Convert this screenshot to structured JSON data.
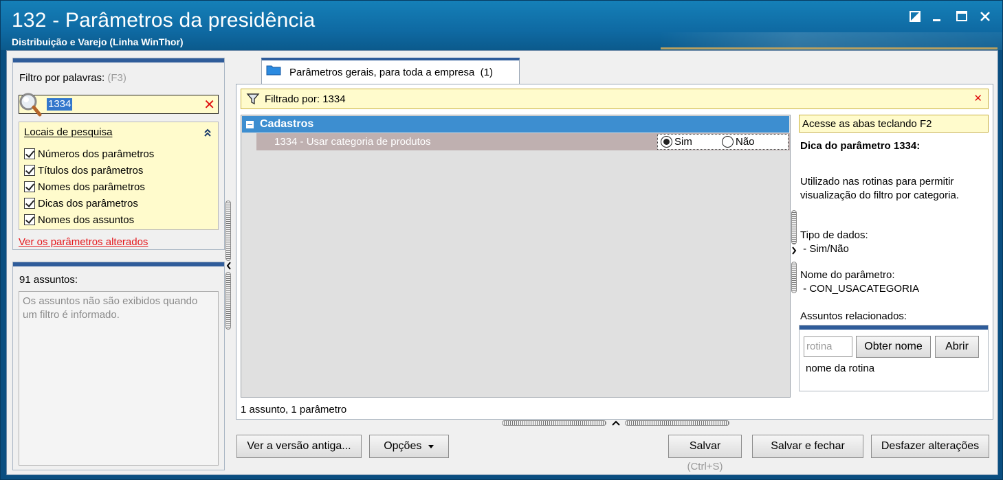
{
  "window": {
    "title": "132 - Parâmetros da presidência",
    "subtitle": "Distribuição e Varejo (Linha WinThor)",
    "controls": [
      "restore-icon",
      "minimize-icon",
      "maximize-icon",
      "close-icon"
    ]
  },
  "filter_panel": {
    "label": "Filtro por palavras:",
    "shortcut": "(F3)",
    "search_value": "1334",
    "clear_glyph": "✕",
    "locais": {
      "title": "Locais de pesquisa",
      "options": [
        {
          "label": "Números dos parâmetros",
          "checked": true
        },
        {
          "label": "Títulos dos parâmetros",
          "checked": true
        },
        {
          "label": "Nomes dos parâmetros",
          "checked": true
        },
        {
          "label": "Dicas dos parâmetros",
          "checked": true
        },
        {
          "label": "Nomes dos assuntos",
          "checked": true
        }
      ]
    },
    "changed_link": "Ver os parâmetros alterados"
  },
  "subjects_panel": {
    "count_label": "91 assuntos:",
    "empty_message": "Os assuntos não são exibidos quando um filtro é informado."
  },
  "tab": {
    "label": "Parâmetros gerais, para toda a empresa",
    "count": "(1)"
  },
  "filterbar": {
    "text": "Filtrado por: 1334",
    "clear_glyph": "✕"
  },
  "grid": {
    "group": "Cadastros",
    "rows": [
      {
        "label": "1334 - Usar categoria de produtos",
        "options": [
          "Sim",
          "Não"
        ],
        "selected": "Sim"
      }
    ]
  },
  "status": "1 assunto, 1 parâmetro",
  "hint_panel": {
    "banner": "Acesse as abas teclando F2",
    "heading": "Dica do parâmetro 1334:",
    "description_1": "Utilizado nas rotinas para permitir",
    "description_2": "visualização do filtro por categoria.",
    "data_type_label": "Tipo de dados:",
    "data_type_value": " - Sim/Não",
    "param_name_label": "Nome do parâmetro:",
    "param_name_value": " - CON_USACATEGORIA",
    "related_label": "Assuntos relacionados:",
    "rotina_placeholder": "rotina",
    "get_name_button": "Obter nome",
    "open_button": "Abrir",
    "rotina_name": "nome da rotina"
  },
  "footer": {
    "old_version_button": "Ver a versão antiga...",
    "options_button": "Opções",
    "save_button": "Salvar",
    "save_shortcut": "(Ctrl+S)",
    "save_close_button": "Salvar e fechar",
    "undo_button": "Desfazer alterações"
  },
  "colors": {
    "title_bar": "#1580b8",
    "accent_band": "#2f5c9a",
    "highlight_yellow": "#fffbcc",
    "group_header": "#3d8ed0",
    "link_red": "#e4161b"
  }
}
